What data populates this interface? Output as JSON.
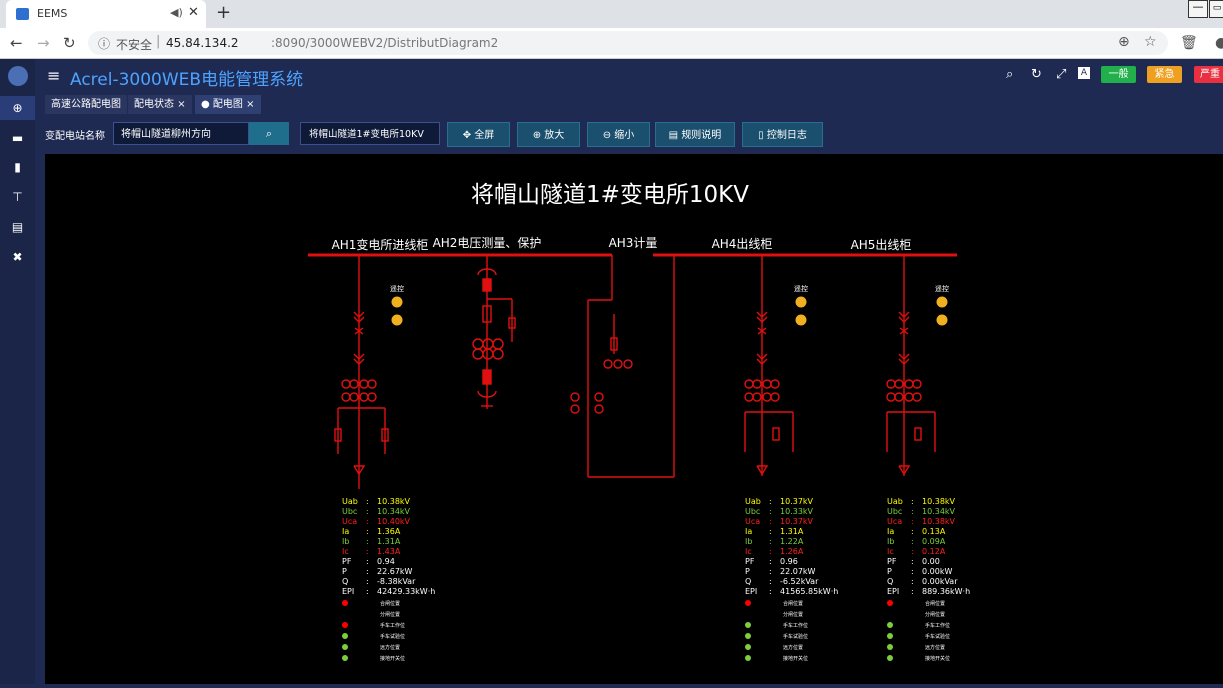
{
  "browser": {
    "tab_title": "EEMS",
    "tab_speaker": "◀)",
    "tab_close": "✕",
    "new_tab": "+",
    "security_label": "不安全",
    "url_host": "45.84.134.2",
    "url_path": ":8090/3000WEBV2/DistributDiagram2"
  },
  "app": {
    "title": "Acrel-3000WEB电能管理系统",
    "badges": {
      "general": "一般",
      "urgent": "紧急",
      "severe": "严重"
    }
  },
  "page_tabs": [
    {
      "label": "高速公路配电图"
    },
    {
      "label": "配电状态"
    },
    {
      "label": "配电图"
    }
  ],
  "toolbar": {
    "station_label": "变配电站名称",
    "station_value": "将帽山隧道柳州方向",
    "select_value": "将帽山隧道1#变电所10KV",
    "buttons": {
      "fullscreen": "全屏",
      "zoom_in": "放大",
      "zoom_out": "缩小",
      "rules": "规则说明",
      "control_log": "控制日志"
    }
  },
  "diagram": {
    "title": "将帽山隧道1#变电所10KV",
    "cabinets": [
      "AH1变电所进线柜",
      "AH2电压测量、保护",
      "AH3计量",
      "AH4出线柜",
      "AH5出线柜"
    ],
    "remote_label": "遥控",
    "meter_labels": [
      "Uab",
      "Ubc",
      "Uca",
      "Ia",
      "Ib",
      "Ic",
      "PF",
      "P",
      "Q",
      "EPI"
    ],
    "readings": {
      "ah1": [
        "10.38kV",
        "10.34kV",
        "10.40kV",
        "1.36A",
        "1.31A",
        "1.43A",
        "0.94",
        "22.67kW",
        "-8.38kVar",
        "42429.33kW·h"
      ],
      "ah4": [
        "10.37kV",
        "10.33kV",
        "10.37kV",
        "1.31A",
        "1.22A",
        "1.26A",
        "0.96",
        "22.07kW",
        "-6.52kVar",
        "41565.85kW·h"
      ],
      "ah5": [
        "10.38kV",
        "10.34kV",
        "10.38kV",
        "0.13A",
        "0.09A",
        "0.12A",
        "0.00",
        "0.00kW",
        "0.00kVar",
        "889.36kW·h"
      ]
    },
    "status_labels": [
      "合闸位置",
      "分闸位置",
      "手车工作位",
      "手车试验位",
      "远方位置",
      "接地开关位"
    ],
    "status_colors": {
      "ah1": [
        "#ff0000",
        "",
        "#ff0000",
        "#7ccf3a",
        "#7ccf3a",
        "#7ccf3a"
      ],
      "ah4": [
        "#ff0000",
        "",
        "#7ccf3a",
        "#7ccf3a",
        "#7ccf3a",
        "#7ccf3a"
      ],
      "ah5": [
        "#ff0000",
        "",
        "#7ccf3a",
        "#7ccf3a",
        "#7ccf3a",
        "#7ccf3a"
      ]
    },
    "colors": {
      "line": "#e01010",
      "voltage_a": "#ffff00",
      "voltage_b": "#7ccf3a",
      "voltage_c": "#ff2020",
      "lamp": "#f0b020"
    }
  }
}
